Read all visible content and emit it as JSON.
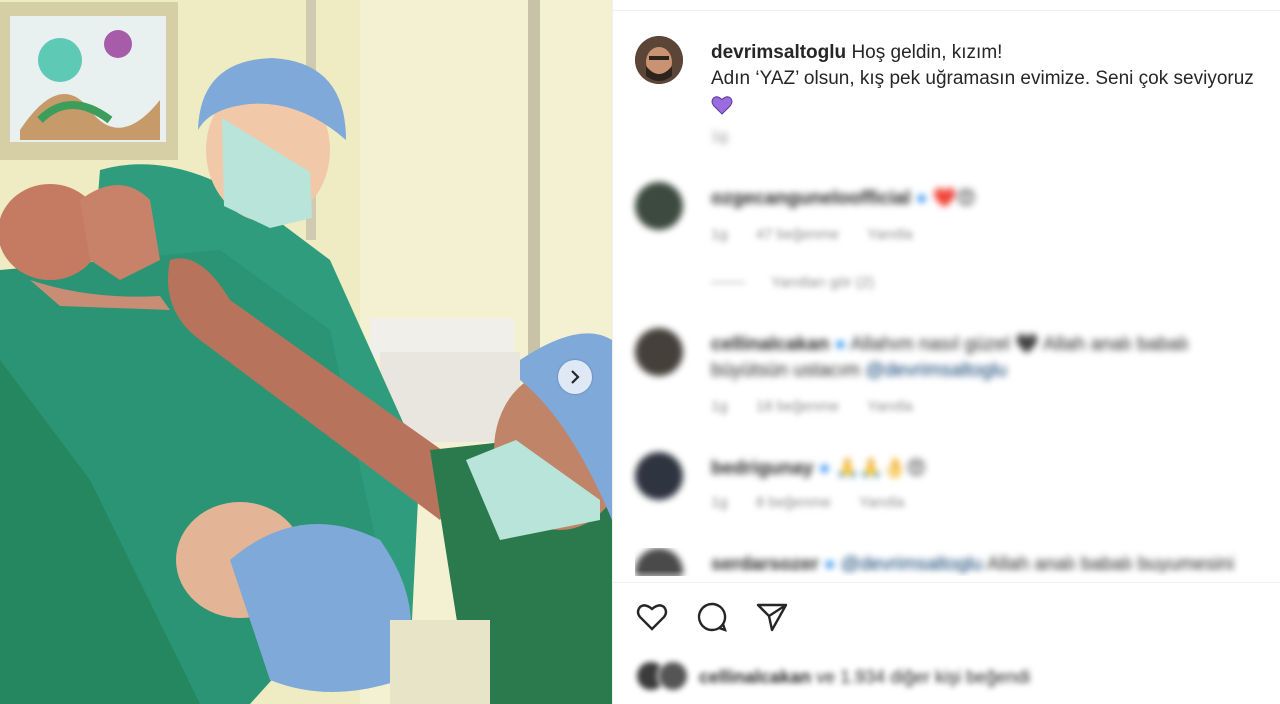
{
  "post": {
    "author": "devrimsaltoglu",
    "caption_line1": "Hoş geldin, kızım!",
    "caption_line2": "Adın ‘YAZ’ olsun, kış pek uğramasın evimize. Seni çok seviyoruz",
    "caption_emoji": "purple-heart",
    "time": "1g"
  },
  "comments": [
    {
      "username": "ozgecanguneloofficial",
      "verified": true,
      "text": "",
      "emoji": "❤️😍",
      "time": "1g",
      "likes": "47 beğenme",
      "reply": "Yanıtla"
    },
    {
      "username": "cellinalcakan",
      "verified": true,
      "text": "Allahım nasıl güzel 🖤 Allah analı babalı büyütsün ustacım",
      "mention": "@devrimsaltoglu",
      "time": "1g",
      "likes": "18 beğenme",
      "reply": "Yanıtla"
    },
    {
      "username": "bedrigunay",
      "verified": true,
      "text": "🙏🙏👌😍",
      "time": "1g",
      "likes": "8 beğenme",
      "reply": "Yanıtla"
    },
    {
      "username": "serdarsozer",
      "verified": true,
      "mention": "@devrimsaltoglu",
      "text": "Allah analı babalı buyumesini"
    }
  ],
  "view_replies": "Yanıtları gör (2)",
  "likes_summary": {
    "user": "cellinalcakan",
    "rest": "ve 1.934 diğer kişi beğendi"
  },
  "colors": {
    "scrubs": "#2e9c7c",
    "mask": "#b8e3d8",
    "cap": "#7ba7d6",
    "verified": "#3897f0",
    "wall": "#f3f0cf"
  }
}
